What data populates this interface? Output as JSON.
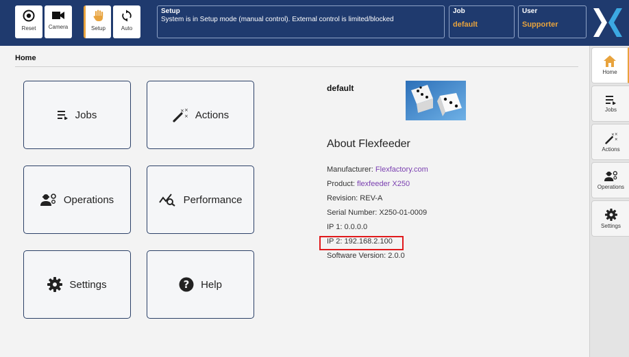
{
  "toolbar": {
    "reset_label": "Reset",
    "camera_label": "Camera",
    "setup_label": "Setup",
    "auto_label": "Auto"
  },
  "status": {
    "title": "Setup",
    "message": "System is in Setup mode (manual control). External control is limited/blocked"
  },
  "job": {
    "title": "Job",
    "value": "default"
  },
  "user": {
    "title": "User",
    "value": "Supporter"
  },
  "colors": {
    "header": "#1f3a6e",
    "accent": "#e8a33d",
    "highlight": "#e0191b",
    "link": "#7a3fb0"
  },
  "breadcrumb": "Home",
  "tiles": {
    "jobs": "Jobs",
    "actions": "Actions",
    "operations": "Operations",
    "performance": "Performance",
    "settings": "Settings",
    "help": "Help"
  },
  "job_panel": {
    "name": "default",
    "about_title": "About Flexfeeder"
  },
  "about": {
    "manufacturer_label": "Manufacturer: ",
    "manufacturer_value": "Flexfactory.com",
    "product_label": "Product: ",
    "product_value": "flexfeeder X250",
    "revision": "Revision: REV-A",
    "serial": "Serial Number: X250-01-0009",
    "ip1": "IP 1: 0.0.0.0",
    "ip2": "IP 2: 192.168.2.100",
    "software": "Software Version: 2.0.0"
  },
  "sidebar": {
    "home": "Home",
    "jobs": "Jobs",
    "actions": "Actions",
    "operations": "Operations",
    "settings": "Settings"
  }
}
